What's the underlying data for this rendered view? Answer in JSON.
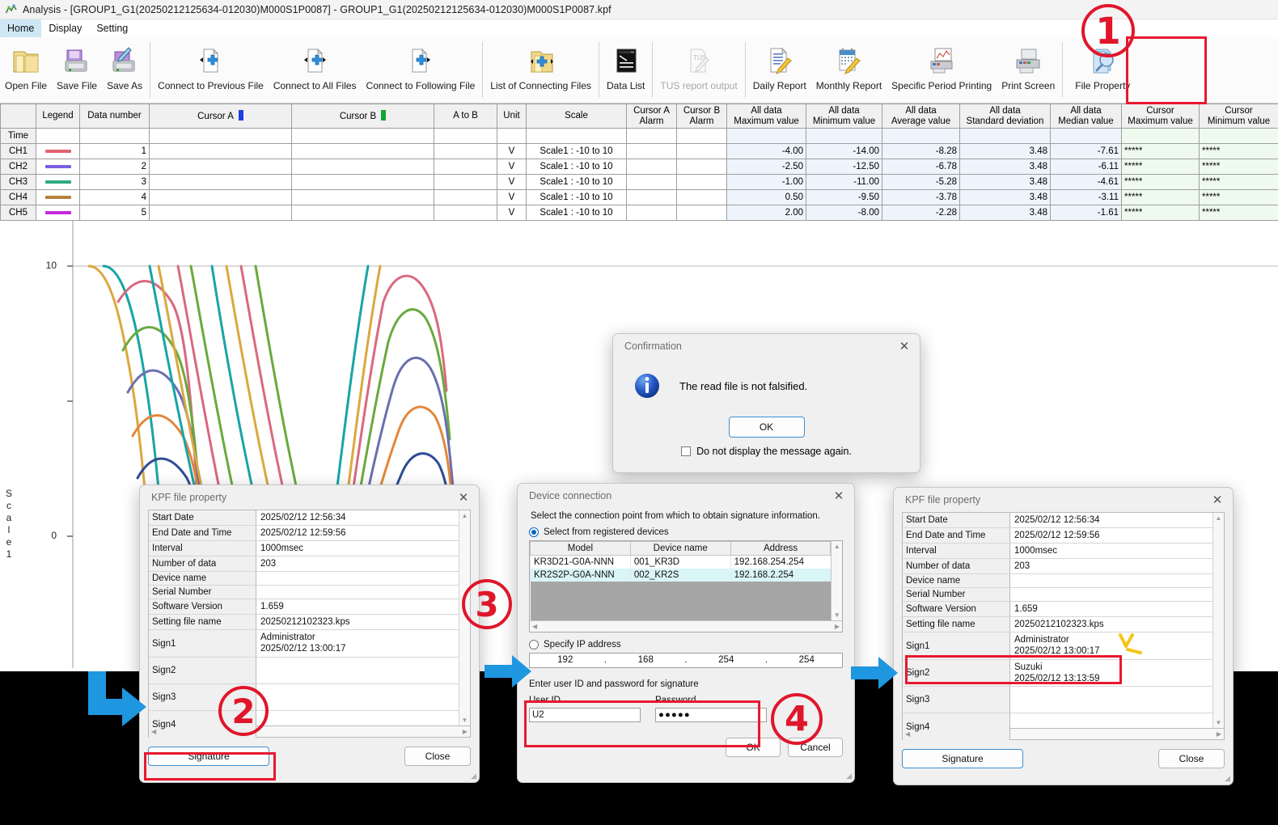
{
  "window": {
    "title": "Analysis - [GROUP1_G1(20250212125634-012030)M000S1P0087] - GROUP1_G1(20250212125634-012030)M000S1P0087.kpf",
    "app_icon": "analysis-app-icon"
  },
  "menu": {
    "items": [
      "Home",
      "Display",
      "Setting"
    ],
    "active": "Home"
  },
  "ribbon": {
    "buttons": [
      {
        "label": "Open File",
        "icon": "open-folder-icon",
        "disabled": false
      },
      {
        "label": "Save File",
        "icon": "floppy-disk-icon",
        "disabled": false
      },
      {
        "label": "Save As",
        "icon": "floppy-disk-pen-icon",
        "disabled": false
      },
      {
        "label": "Connect to Previous File",
        "icon": "doc-prev-plus-icon",
        "disabled": false
      },
      {
        "label": "Connect to All Files",
        "icon": "doc-all-plus-icon",
        "disabled": false
      },
      {
        "label": "Connect to Following File",
        "icon": "doc-next-plus-icon",
        "disabled": false
      },
      {
        "label": "List of Connecting Files",
        "icon": "folder-list-icon",
        "disabled": false
      },
      {
        "label": "Data List",
        "icon": "data-list-icon",
        "disabled": false
      },
      {
        "label": "TUS report output",
        "icon": "tus-report-icon",
        "disabled": true
      },
      {
        "label": "Daily Report",
        "icon": "daily-report-icon",
        "disabled": false
      },
      {
        "label": "Monthly Report",
        "icon": "monthly-report-icon",
        "disabled": false
      },
      {
        "label": "Specific Period Printing",
        "icon": "period-print-icon",
        "disabled": false
      },
      {
        "label": "Print Screen",
        "icon": "printer-icon",
        "disabled": false
      },
      {
        "label": "File Property",
        "icon": "file-property-icon",
        "disabled": false
      }
    ]
  },
  "table": {
    "headers": [
      "",
      "Legend",
      "Data number",
      "Cursor A",
      "Cursor B",
      "A to B",
      "Unit",
      "Scale",
      "Cursor A\nAlarm",
      "Cursor B\nAlarm",
      "All data\nMaximum value",
      "All data\nMinimum value",
      "All data\nAverage value",
      "All data\nStandard deviation",
      "All data\nMedian value",
      "Cursor\nMaximum value",
      "Cursor\nMinimum value"
    ],
    "header_lines": [
      [
        "",
        ""
      ],
      [
        "Legend",
        ""
      ],
      [
        "Data number",
        ""
      ],
      [
        "Cursor A",
        ""
      ],
      [
        "Cursor B",
        ""
      ],
      [
        "A to B",
        ""
      ],
      [
        "Unit",
        ""
      ],
      [
        "Scale",
        ""
      ],
      [
        "Cursor A",
        "Alarm"
      ],
      [
        "Cursor B",
        "Alarm"
      ],
      [
        "All data",
        "Maximum value"
      ],
      [
        "All data",
        "Minimum value"
      ],
      [
        "All data",
        "Average value"
      ],
      [
        "All data",
        "Standard deviation"
      ],
      [
        "All data",
        "Median value"
      ],
      [
        "Cursor",
        "Maximum value"
      ],
      [
        "Cursor",
        "Minimum value"
      ]
    ],
    "cursor_a_color": "#1f3fe0",
    "cursor_b_color": "#11a534",
    "time_row_label": "Time",
    "rows": [
      {
        "name": "CH1",
        "legend_color": "#e0636f",
        "data_number": "1",
        "cursor_a": "",
        "cursor_b": "",
        "a_to_b": "",
        "unit": "V",
        "scale": "Scale1 : -10 to 10",
        "alarm_a": "",
        "alarm_b": "",
        "max": "-4.00",
        "min": "-14.00",
        "avg": "-8.28",
        "sd": "3.48",
        "median": "-7.61",
        "cursor_max": "*****",
        "cursor_min": "*****"
      },
      {
        "name": "CH2",
        "legend_color": "#7b5fe0",
        "data_number": "2",
        "cursor_a": "",
        "cursor_b": "",
        "a_to_b": "",
        "unit": "V",
        "scale": "Scale1 : -10 to 10",
        "alarm_a": "",
        "alarm_b": "",
        "max": "-2.50",
        "min": "-12.50",
        "avg": "-6.78",
        "sd": "3.48",
        "median": "-6.11",
        "cursor_max": "*****",
        "cursor_min": "*****"
      },
      {
        "name": "CH3",
        "legend_color": "#2fab83",
        "data_number": "3",
        "cursor_a": "",
        "cursor_b": "",
        "a_to_b": "",
        "unit": "V",
        "scale": "Scale1 : -10 to 10",
        "alarm_a": "",
        "alarm_b": "",
        "max": "-1.00",
        "min": "-11.00",
        "avg": "-5.28",
        "sd": "3.48",
        "median": "-4.61",
        "cursor_max": "*****",
        "cursor_min": "*****"
      },
      {
        "name": "CH4",
        "legend_color": "#b5823b",
        "data_number": "4",
        "cursor_a": "",
        "cursor_b": "",
        "a_to_b": "",
        "unit": "V",
        "scale": "Scale1 : -10 to 10",
        "alarm_a": "",
        "alarm_b": "",
        "max": "0.50",
        "min": "-9.50",
        "avg": "-3.78",
        "sd": "3.48",
        "median": "-3.11",
        "cursor_max": "*****",
        "cursor_min": "*****"
      },
      {
        "name": "CH5",
        "legend_color": "#c328dd",
        "data_number": "5",
        "cursor_a": "",
        "cursor_b": "",
        "a_to_b": "",
        "unit": "V",
        "scale": "Scale1 : -10 to 10",
        "alarm_a": "",
        "alarm_b": "",
        "max": "2.00",
        "min": "-8.00",
        "avg": "-2.28",
        "sd": "3.48",
        "median": "-1.61",
        "cursor_max": "*****",
        "cursor_min": "*****"
      }
    ]
  },
  "chart": {
    "y_axis_label": "Scale 1",
    "y_axis_label_chars": [
      "S",
      "c",
      "a",
      "l",
      "e",
      "1"
    ],
    "ticks": [
      "10",
      "",
      "0"
    ],
    "tick_top": "10",
    "tick_zero": "0",
    "trace_colors": [
      "#dba83e",
      "#17a5a5",
      "#d9697f",
      "#6aa93e",
      "#6b6fae",
      "#e3873c",
      "#2f4c96",
      "#a32fd0",
      "#8a5a2b",
      "#2f8f6b",
      "#6a4fd0"
    ],
    "annotation": "magenta-freehand-mark"
  },
  "confirmation_dialog": {
    "title": "Confirmation",
    "icon": "info-icon",
    "message": "The read file is not falsified.",
    "ok_label": "OK",
    "checkbox_label": "Do not display the message again.",
    "checkbox_checked": false,
    "close_icon": "close-icon"
  },
  "kpf_dialog_left": {
    "title": "KPF file property",
    "close_icon": "close-icon",
    "rows": [
      {
        "key": "Start Date",
        "value": "2025/02/12 12:56:34",
        "value2": ""
      },
      {
        "key": "End Date and Time",
        "value": "2025/02/12 12:59:56",
        "value2": ""
      },
      {
        "key": "Interval",
        "value": "1000msec",
        "value2": ""
      },
      {
        "key": "Number of data",
        "value": "203",
        "value2": ""
      },
      {
        "key": "Device name",
        "value": "",
        "value2": ""
      },
      {
        "key": "Serial Number",
        "value": "",
        "value2": ""
      },
      {
        "key": "Software Version",
        "value": "1.659",
        "value2": ""
      },
      {
        "key": "Setting file name",
        "value": "20250212102323.kps",
        "value2": ""
      },
      {
        "key": "Sign1",
        "value": "Administrator",
        "value2": "2025/02/12 13:00:17"
      },
      {
        "key": "Sign2",
        "value": "",
        "value2": ""
      },
      {
        "key": "Sign3",
        "value": "",
        "value2": ""
      },
      {
        "key": "Sign4",
        "value": "",
        "value2": ""
      }
    ],
    "signature_label": "Signature",
    "close_label": "Close"
  },
  "device_dialog": {
    "title": "Device connection",
    "close_icon": "close-icon",
    "note": "Select the connection point from which to obtain signature information.",
    "radio_registered_label": "Select from registered devices",
    "radio_registered_selected": true,
    "radio_ip_label": "Specify IP address",
    "radio_ip_selected": false,
    "device_headers": [
      "Model",
      "Device name",
      "Address"
    ],
    "devices": [
      {
        "model": "KR3D21-G0A-NNN",
        "device_name": "001_KR3D",
        "address": "192.168.254.254",
        "selected": false
      },
      {
        "model": "KR2S2P-G0A-NNN",
        "device_name": "002_KR2S",
        "address": "192.168.2.254",
        "selected": true
      }
    ],
    "ip_segments": [
      "192",
      "168",
      "254",
      "254"
    ],
    "credentials_group_label": "Enter user ID and password for signature",
    "user_id_label": "User ID",
    "user_id_value": "U2",
    "password_label": "Password",
    "password_value": "●●●●●",
    "ok_label": "OK",
    "cancel_label": "Cancel"
  },
  "kpf_dialog_right": {
    "title": "KPF file property",
    "close_icon": "close-icon",
    "rows": [
      {
        "key": "Start Date",
        "value": "2025/02/12 12:56:34",
        "value2": ""
      },
      {
        "key": "End Date and Time",
        "value": "2025/02/12 12:59:56",
        "value2": ""
      },
      {
        "key": "Interval",
        "value": "1000msec",
        "value2": ""
      },
      {
        "key": "Number of data",
        "value": "203",
        "value2": ""
      },
      {
        "key": "Device name",
        "value": "",
        "value2": ""
      },
      {
        "key": "Serial Number",
        "value": "",
        "value2": ""
      },
      {
        "key": "Software Version",
        "value": "1.659",
        "value2": ""
      },
      {
        "key": "Setting file name",
        "value": "20250212102323.kps",
        "value2": ""
      },
      {
        "key": "Sign1",
        "value": "Administrator",
        "value2": "2025/02/12 13:00:17"
      },
      {
        "key": "Sign2",
        "value": "Suzuki",
        "value2": "2025/02/12 13:13:59"
      },
      {
        "key": "Sign3",
        "value": "",
        "value2": ""
      },
      {
        "key": "Sign4",
        "value": "",
        "value2": ""
      }
    ],
    "signature_label": "Signature",
    "close_label": "Close"
  },
  "annotations": {
    "step_numbers": [
      "1",
      "2",
      "3",
      "4"
    ],
    "highlight_color": "#e0162b",
    "arrow_color": "#1f96e0",
    "sparkle_color": "#f5c518"
  }
}
